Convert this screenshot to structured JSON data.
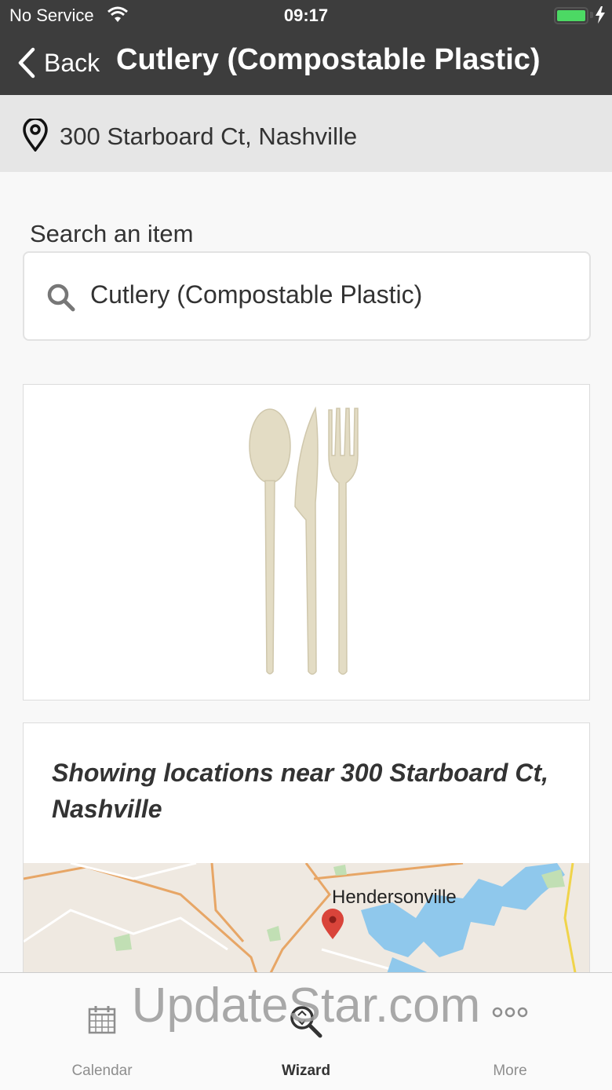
{
  "status": {
    "carrier": "No Service",
    "time": "09:17"
  },
  "nav": {
    "back_label": "Back",
    "title": "Cutlery (Compostable Plastic)"
  },
  "location": {
    "address": "300 Starboard Ct, Nashville"
  },
  "search": {
    "label": "Search an item",
    "value": "Cutlery (Compostable Plastic)"
  },
  "results": {
    "heading": "Showing locations near 300 Starboard Ct, Nashville",
    "map_city": "Hendersonville"
  },
  "tabs": [
    {
      "label": "Calendar",
      "icon": "calendar-icon"
    },
    {
      "label": "Wizard",
      "icon": "wizard-icon"
    },
    {
      "label": "More",
      "icon": "more-icon"
    }
  ],
  "watermark": "UpdateStar.com",
  "colors": {
    "header": "#3d3d3d",
    "battery": "#4cd964",
    "map_pin": "#d9443a",
    "water": "#8fc8ec"
  }
}
